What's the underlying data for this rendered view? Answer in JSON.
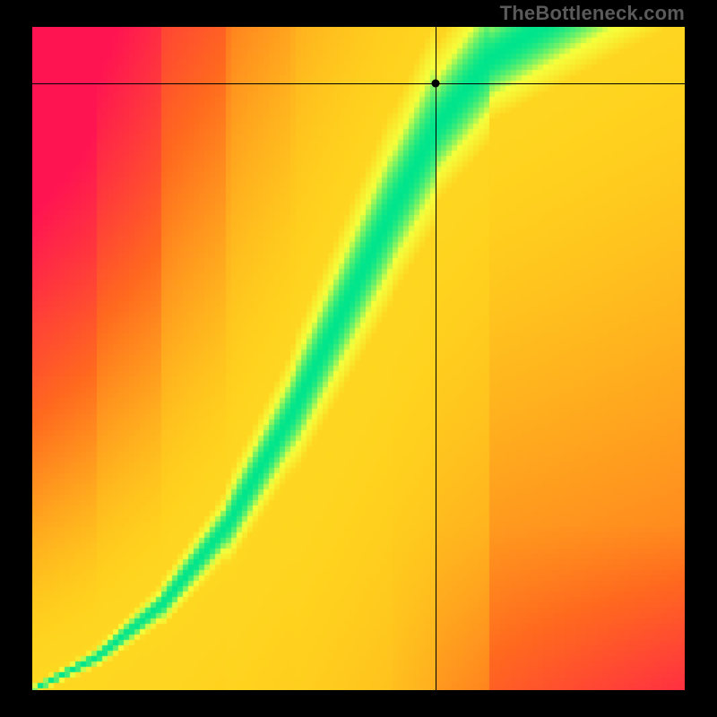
{
  "watermark": "TheBottleneck.com",
  "chart_data": {
    "type": "heatmap",
    "title": "",
    "xlabel": "",
    "ylabel": "",
    "xlim": [
      0,
      1
    ],
    "ylim": [
      0,
      1
    ],
    "grid": false,
    "legend": false,
    "palette": {
      "low": "#ff1452",
      "midlow": "#ff6a1e",
      "mid": "#ffd21e",
      "high": "#f5ff3c",
      "peak": "#00e58c"
    },
    "optimum_curve": {
      "description": "ridge of peak color running from bottom-left origin upward with superlinear (S-shaped) curvature toward upper-center-right",
      "control_points": [
        {
          "x": 0.0,
          "y": 0.0
        },
        {
          "x": 0.1,
          "y": 0.05
        },
        {
          "x": 0.2,
          "y": 0.13
        },
        {
          "x": 0.3,
          "y": 0.25
        },
        {
          "x": 0.4,
          "y": 0.42
        },
        {
          "x": 0.48,
          "y": 0.58
        },
        {
          "x": 0.55,
          "y": 0.72
        },
        {
          "x": 0.62,
          "y": 0.85
        },
        {
          "x": 0.7,
          "y": 0.95
        },
        {
          "x": 0.78,
          "y": 1.0
        }
      ],
      "band_halfwidth_normalized": 0.055
    },
    "crosshair": {
      "x": 0.618,
      "y": 0.915
    },
    "marker": {
      "x": 0.618,
      "y": 0.915
    },
    "pixelation": 6
  }
}
